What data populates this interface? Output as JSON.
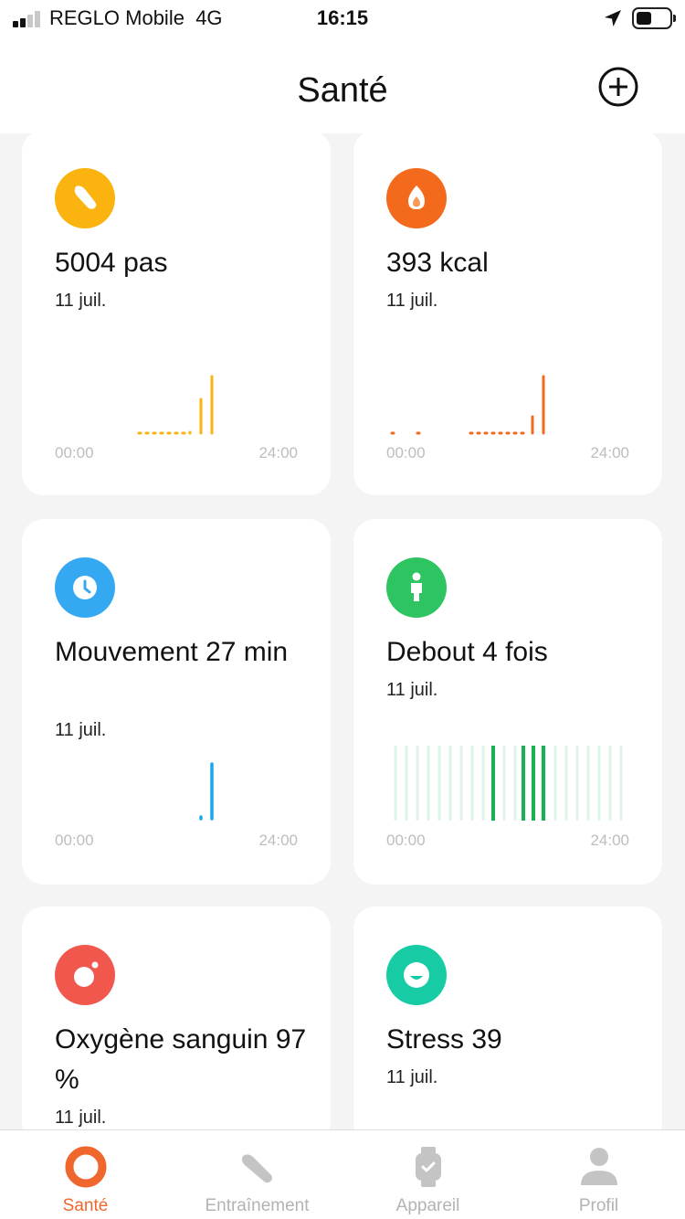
{
  "status_bar": {
    "carrier": "REGLO Mobile",
    "network": "4G",
    "time": "16:15"
  },
  "header": {
    "title": "Santé",
    "add_icon": "plus-circle-icon"
  },
  "cards": [
    {
      "id": "steps",
      "value": "5004 pas",
      "date": "11 juil.",
      "axis_start": "00:00",
      "axis_end": "24:00",
      "icon": "shoe-icon",
      "color": "#fbb30f"
    },
    {
      "id": "calories",
      "value": "393 kcal",
      "date": "11 juil.",
      "axis_start": "00:00",
      "axis_end": "24:00",
      "icon": "flame-icon",
      "color": "#f36a1c"
    },
    {
      "id": "movement",
      "value": "Mouvement 27 min",
      "date": "11 juil.",
      "axis_start": "00:00",
      "axis_end": "24:00",
      "icon": "clock-icon",
      "color": "#34a9f2"
    },
    {
      "id": "standing",
      "value": "Debout 4 fois",
      "date": "11 juil.",
      "axis_start": "00:00",
      "axis_end": "24:00",
      "icon": "person-icon",
      "color": "#2ec461"
    },
    {
      "id": "oxygen",
      "value": "Oxygène sanguin 97 %",
      "date": "11 juil.",
      "icon": "oxygen-icon",
      "color": "#f2574d"
    },
    {
      "id": "stress",
      "value": "Stress 39",
      "date": "11 juil.",
      "icon": "smile-icon",
      "color": "#17cca4"
    }
  ],
  "tabbar": [
    {
      "label": "Santé",
      "icon": "health-ring-icon",
      "active": true,
      "color": "#f0672e"
    },
    {
      "label": "Entraînement",
      "icon": "shoe-icon",
      "active": false
    },
    {
      "label": "Appareil",
      "icon": "watch-icon",
      "active": false
    },
    {
      "label": "Profil",
      "icon": "user-icon",
      "active": false
    }
  ]
}
